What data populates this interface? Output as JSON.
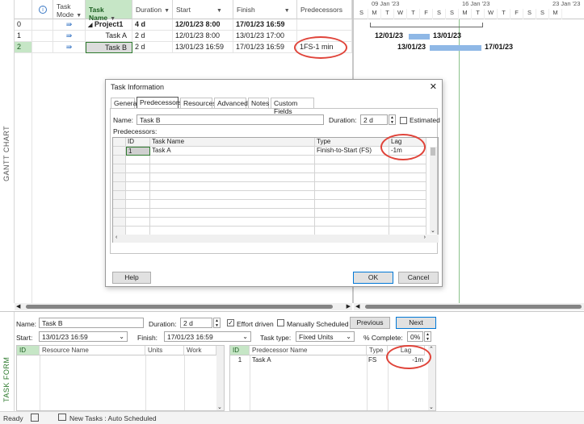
{
  "side_labels": {
    "gantt": "GANTT CHART",
    "task_form": "TASK FORM"
  },
  "grid": {
    "headers": {
      "mode_line1": "Task",
      "mode_line2": "Mode",
      "name": "Task Name",
      "duration": "Duration",
      "start": "Start",
      "finish": "Finish",
      "predecessors": "Predecessors"
    },
    "rows": [
      {
        "id": "0",
        "name": "Project1",
        "duration": "4 d",
        "start": "12/01/23 8:00",
        "finish": "17/01/23 16:59",
        "predecessors": ""
      },
      {
        "id": "1",
        "name": "Task A",
        "duration": "2 d",
        "start": "12/01/23 8:00",
        "finish": "13/01/23 17:00",
        "predecessors": ""
      },
      {
        "id": "2",
        "name": "Task B",
        "duration": "2 d",
        "start": "13/01/23 16:59",
        "finish": "17/01/23 16:59",
        "predecessors": "1FS-1 min"
      }
    ]
  },
  "timeline": {
    "weeks": [
      "09 Jan '23",
      "16 Jan '23",
      "23 Jan '23"
    ],
    "days": [
      "S",
      "M",
      "T",
      "W",
      "T",
      "F",
      "S",
      "S",
      "M",
      "T",
      "W",
      "T",
      "F",
      "S",
      "S",
      "M"
    ],
    "labels": {
      "task_a_start": "12/01/23",
      "task_a_end": "13/01/23",
      "task_b_start": "13/01/23",
      "task_b_end": "17/01/23"
    }
  },
  "dialog": {
    "title": "Task Information",
    "close": "✕",
    "tabs": [
      "General",
      "Predecessors",
      "Resources",
      "Advanced",
      "Notes",
      "Custom Fields"
    ],
    "name_label": "Name:",
    "name_value": "Task B",
    "duration_label": "Duration:",
    "duration_value": "2 d",
    "estimated_label": "Estimated",
    "predecessors_label": "Predecessors:",
    "columns": {
      "id": "ID",
      "name": "Task Name",
      "type": "Type",
      "lag": "Lag"
    },
    "rows": [
      {
        "id": "1",
        "name": "Task A",
        "type": "Finish-to-Start (FS)",
        "lag": "-1m"
      }
    ],
    "help": "Help",
    "ok": "OK",
    "cancel": "Cancel"
  },
  "task_form": {
    "name_label": "Name:",
    "name_value": "Task B",
    "duration_label": "Duration:",
    "duration_value": "2 d",
    "effort_driven_label": "Effort driven",
    "manual_label": "Manually Scheduled",
    "previous": "Previous",
    "next": "Next",
    "start_label": "Start:",
    "start_value": "13/01/23 16:59",
    "finish_label": "Finish:",
    "finish_value": "17/01/23 16:59",
    "task_type_label": "Task type:",
    "task_type_value": "Fixed Units",
    "complete_label": "% Complete:",
    "complete_value": "0%",
    "res_columns": {
      "id": "ID",
      "name": "Resource Name",
      "units": "Units",
      "work": "Work"
    },
    "pred_columns": {
      "id": "ID",
      "name": "Predecessor Name",
      "type": "Type",
      "lag": "Lag"
    },
    "pred_rows": [
      {
        "id": "1",
        "name": "Task A",
        "type": "FS",
        "lag": "-1m"
      }
    ]
  },
  "status": {
    "ready": "Ready",
    "new_tasks": "New Tasks : Auto Scheduled"
  },
  "colors": {
    "accent_green": "#c6e6c6",
    "bar_blue": "#8fb8e6",
    "highlight_red": "#e0443a"
  }
}
